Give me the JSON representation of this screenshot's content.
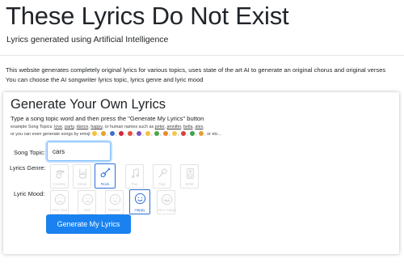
{
  "header": {
    "title": "These Lyrics Do Not Exist",
    "subtitle": "Lyrics generated using Artificial Intelligence"
  },
  "intro": {
    "line1": "This website generates completely original lyrics for various topics, uses state of the art AI to generate an original chorus and original verses",
    "line2": "You can choose the AI songwriter lyrics topic, lyrics genre and lyric mood"
  },
  "generator": {
    "heading": "Generate Your Own Lyrics",
    "instruction": "Type a song topic word and then press the \"Generate My Lyrics\" button",
    "examples_prefix": "example Song Topics:",
    "example_topics": [
      "love",
      "party",
      "dance",
      "happy"
    ],
    "examples_mid": "or human names such as",
    "example_names": [
      "peter",
      "jennifer",
      "bella",
      "alex"
    ],
    "emoji_prefix": "or you can even generate songs by emoji",
    "emoji_suffix": "or etc...",
    "topic_label": "Song Topic:",
    "topic_value": "cars",
    "genre_label": "Lyrics Genre:",
    "genres": [
      {
        "label": "Country",
        "icon": "guitar-hat-icon",
        "selected": false
      },
      {
        "label": "Metal",
        "icon": "metal-hand-icon",
        "selected": false
      },
      {
        "label": "Rock",
        "icon": "electric-guitar-icon",
        "selected": true
      },
      {
        "label": "Pop",
        "icon": "music-note-icon",
        "selected": false
      },
      {
        "label": "Rap",
        "icon": "microphone-icon",
        "selected": false
      },
      {
        "label": "EDM",
        "icon": "speaker-icon",
        "selected": false
      }
    ],
    "mood_label": "Lyric Mood:",
    "moods": [
      {
        "label": "Very Sad",
        "icon": "very-sad-face-icon",
        "selected": false
      },
      {
        "label": "Sad",
        "icon": "sad-face-icon",
        "selected": false
      },
      {
        "label": "Neutral",
        "icon": "neutral-face-icon",
        "selected": false
      },
      {
        "label": "Happy",
        "icon": "happy-face-icon",
        "selected": true
      },
      {
        "label": "Very Happy",
        "icon": "very-happy-face-icon",
        "selected": false
      }
    ],
    "button_label": "Generate My Lyrics"
  },
  "colors": {
    "accent": "#1a82f0",
    "selected_border": "#2c6fd9",
    "input_focus": "#80bdff",
    "muted_icon": "#d6d6d6"
  }
}
